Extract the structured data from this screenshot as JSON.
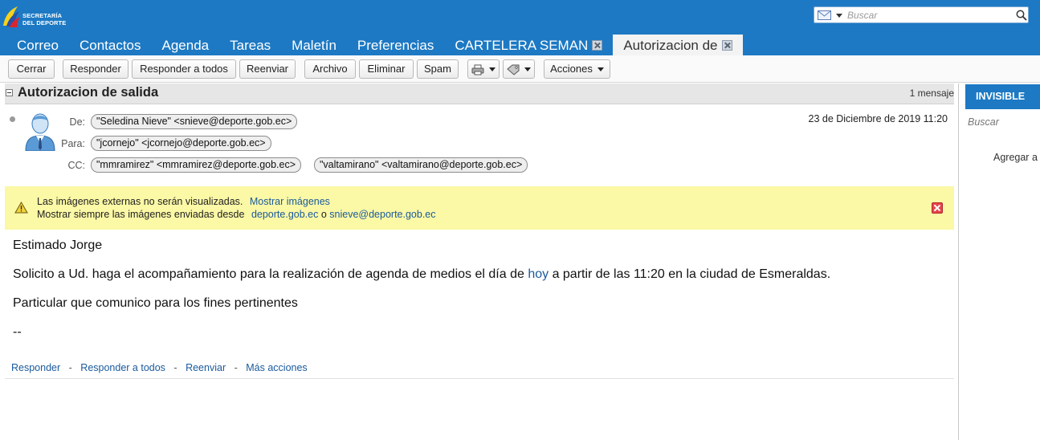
{
  "brand": {
    "logo_line1": "SECRETARÍA",
    "logo_line2": "DEL DEPORTE"
  },
  "search": {
    "placeholder": "Buscar"
  },
  "tabs": [
    {
      "label": "Correo"
    },
    {
      "label": "Contactos"
    },
    {
      "label": "Agenda"
    },
    {
      "label": "Tareas"
    },
    {
      "label": "Maletín"
    },
    {
      "label": "Preferencias"
    },
    {
      "label": "CARTELERA SEMAN"
    },
    {
      "label": "Autorizacion de"
    }
  ],
  "toolbar": {
    "close": "Cerrar",
    "reply": "Responder",
    "reply_all": "Responder a todos",
    "forward": "Reenviar",
    "archive": "Archivo",
    "delete": "Eliminar",
    "spam": "Spam",
    "actions": "Acciones"
  },
  "conversation": {
    "title": "Autorizacion de salida",
    "count": "1 mensaje"
  },
  "message": {
    "from_label": "De:",
    "to_label": "Para:",
    "cc_label": "CC:",
    "from": "\"Seledina Nieve\" <snieve@deporte.gob.ec>",
    "to": "\"jcornejo\" <jcornejo@deporte.gob.ec>",
    "cc": [
      "\"mmramirez\" <mmramirez@deporte.gob.ec>",
      "\"valtamirano\" <valtamirano@deporte.gob.ec>"
    ],
    "date": "23 de Diciembre de 2019 11:20"
  },
  "warning": {
    "text1": "Las imágenes externas no serán visualizadas.",
    "show_images": "Mostrar imágenes",
    "text2": "Mostrar siempre las imágenes enviadas desde",
    "domain": "deporte.gob.ec",
    "or": "o",
    "sender": "snieve@deporte.gob.ec"
  },
  "body": {
    "greeting": "Estimado Jorge",
    "line2_before": "Solicito a Ud. haga el acompañamiento para la realización de agenda de medios el día de",
    "line2_link": "hoy",
    "line2_after": "a partir de las 11:20 en la ciudad de Esmeraldas.",
    "line3": "Particular que comunico para los fines pertinentes",
    "signature": "--"
  },
  "footer": {
    "reply": "Responder",
    "reply_all": "Responder a todos",
    "forward": "Reenviar",
    "more": "Más acciones",
    "sep": "-"
  },
  "right_panel": {
    "title": "INVISIBLE",
    "search": "Buscar",
    "add": "Agregar a"
  },
  "colors": {
    "header_blue": "#1d79c3",
    "warning_yellow": "#fbf8a6",
    "link_blue": "#1a5a9c"
  }
}
